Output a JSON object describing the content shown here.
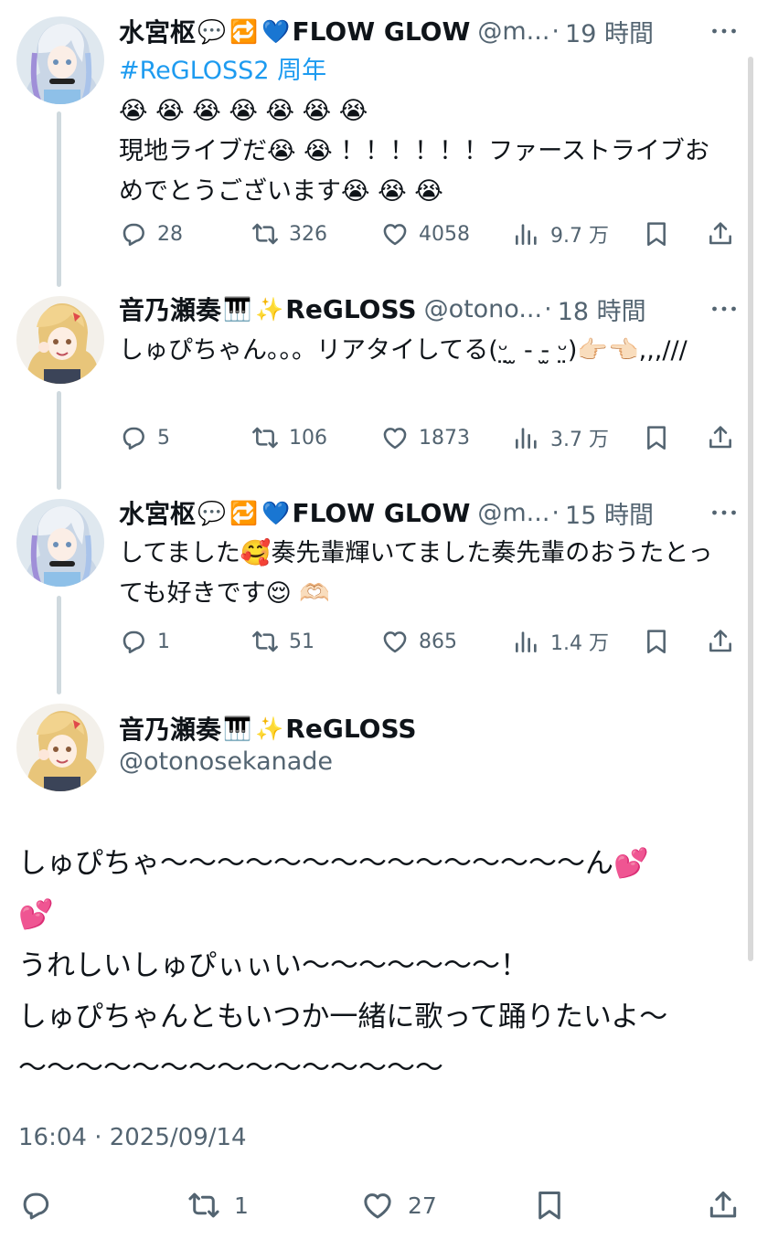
{
  "tweets": [
    {
      "name": "水宮枢",
      "name_emojis": [
        "💬",
        "🔁",
        "💙"
      ],
      "name_suffix": "FLOW GLOW",
      "handle": "@m...",
      "time": "19 時間",
      "hashtag": "#ReGLOSS2 周年",
      "text": "😭 😭 😭 😭 😭 😭 😭\n現地ライブだ😭 😭 ！！！！！！ファーストライブおめでとうございます😭 😭 😭",
      "replies": "28",
      "retweets": "326",
      "likes": "4058",
      "views": "9.7 万"
    },
    {
      "name": "音乃瀬奏",
      "name_emojis": [
        "🎹",
        "✨"
      ],
      "name_suffix": "ReGLOSS",
      "handle": "@otono...",
      "time": "18 時間",
      "text": "しゅぴちゃん。。。リアタイしてる(ᵕ̤ ̫ - -̫ ᵕ̤)👉🏻👈🏻,,,///",
      "replies": "5",
      "retweets": "106",
      "likes": "1873",
      "views": "3.7 万"
    },
    {
      "name": "水宮枢",
      "name_emojis": [
        "💬",
        "🔁",
        "💙"
      ],
      "name_suffix": "FLOW GLOW",
      "handle": "@m...",
      "time": "15 時間",
      "text": "してました🥰奏先輩輝いてました奏先輩のおうたとっても好きです😌 🫶🏻",
      "replies": "1",
      "retweets": "51",
      "likes": "865",
      "views": "1.4 万"
    }
  ],
  "main": {
    "name": "音乃瀬奏",
    "name_emojis": [
      "🎹",
      "✨"
    ],
    "name_suffix": "ReGLOSS",
    "handle": "@otonosekanade",
    "text_line1": "しゅぴちゃ〜〜〜〜〜〜〜〜〜〜〜〜〜〜〜ん💕",
    "text_line2": "💕",
    "text_line3": "うれしいしゅぴぃぃい〜〜〜〜〜〜〜！",
    "text_line4": "しゅぴちゃんともいつか一緒に歌って踊りたいよ〜",
    "text_line5": "〜〜〜〜〜〜〜〜〜〜〜〜〜〜〜",
    "timestamp": "16:04 · 2025/09/14",
    "retweets": "1",
    "likes": "27"
  },
  "icons": {
    "reply": "reply-icon",
    "retweet": "retweet-icon",
    "like": "heart-icon",
    "views": "views-icon",
    "bookmark": "bookmark-icon",
    "share": "share-icon",
    "more": "more-icon"
  },
  "colors": {
    "text": "#0f1419",
    "muted": "#536471",
    "link": "#1d9bf0",
    "thread_line": "#cfd9de"
  }
}
